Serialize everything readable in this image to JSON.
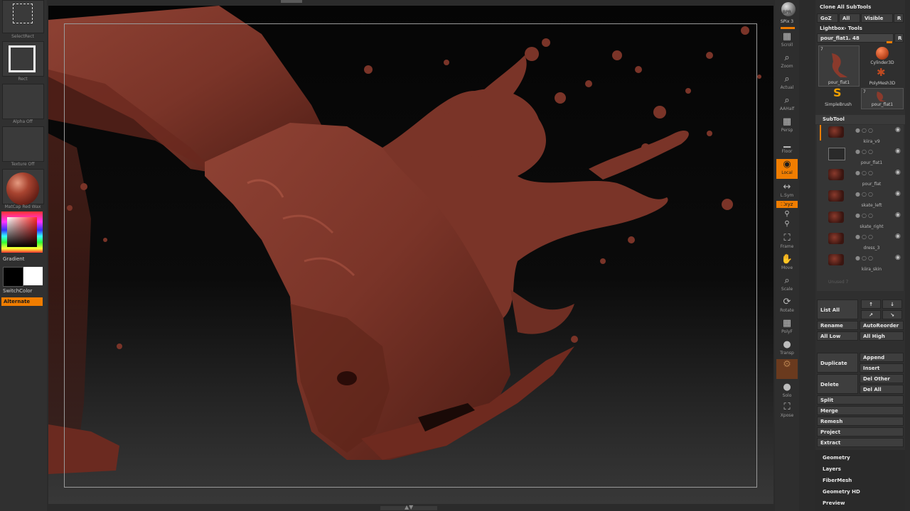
{
  "left_palette": {
    "select_rect_label": "SelectRect",
    "rect_label": "Rect",
    "alpha_label": "Alpha  Off",
    "texture_label": "Texture  Off",
    "material_label": "MatCap  Red  Wax",
    "gradient_label": "Gradient",
    "switch_color_label": "SwitchColor",
    "alternate_label": "Alternate",
    "primary_color": "#000000",
    "secondary_color": "#ffffff"
  },
  "right_toolbar": {
    "bpr": "BPR",
    "spix": "SPix 3",
    "scroll": "Scroll",
    "zoom": "Zoom",
    "actual": "Actual",
    "aahalf": "AAHalf",
    "persp": "Persp",
    "floor": "Floor",
    "local": "Local",
    "lsym": "L.Sym",
    "xyz": "⛶xyz",
    "frame": "Frame",
    "move": "Move",
    "scale": "Scale",
    "rotate": "Rotate",
    "polyf": "PolyF",
    "transp": "Transp",
    "solo": "Solo",
    "xpose": "Xpose",
    "accent": "#f07d00"
  },
  "tool_panel": {
    "clone_all": "Clone  All SubTools",
    "goz": "GoZ",
    "all": "All",
    "visible": "Visible",
    "r": "R",
    "lightbox_tools": "Lightbox› Tools",
    "current_tool": "pour_flat1. 48",
    "r2": "R",
    "tools": [
      {
        "name": "pour_flat1",
        "count": "7"
      },
      {
        "name": "Cylinder3D"
      },
      {
        "name": "PolyMesh3D"
      },
      {
        "name": "SimpleBrush"
      },
      {
        "name": "pour_flat1",
        "count": "7"
      }
    ]
  },
  "subtool": {
    "header": "SubTool",
    "items": [
      {
        "name": "kiira_v9"
      },
      {
        "name": "pour_flat1"
      },
      {
        "name": "pour_flat"
      },
      {
        "name": "skate_left"
      },
      {
        "name": "skate_right"
      },
      {
        "name": "dress_3"
      },
      {
        "name": "kiira_skin"
      }
    ],
    "unused": "Unused 7",
    "list_all": "List  All",
    "rename": "Rename",
    "auto_reorder": "AutoReorder",
    "all_low": "All Low",
    "all_high": "All High",
    "duplicate": "Duplicate",
    "append": "Append",
    "insert": "Insert",
    "delete": "Delete",
    "del_other": "Del Other",
    "del_all": "Del All",
    "split": "Split",
    "merge": "Merge",
    "remesh": "Remesh",
    "project": "Project",
    "extract": "Extract"
  },
  "sections": [
    "Geometry",
    "Layers",
    "FiberMesh",
    "Geometry HD",
    "Preview"
  ],
  "viewport": {
    "model_color": "#7a3428"
  }
}
